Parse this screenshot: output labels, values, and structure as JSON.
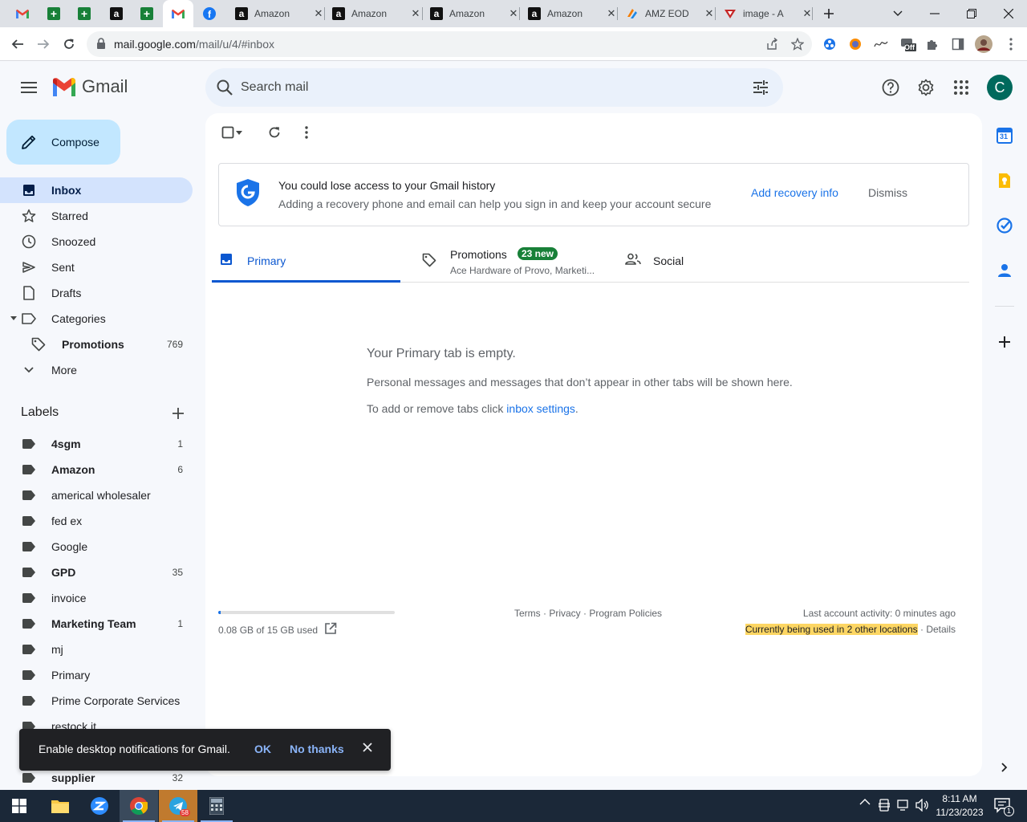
{
  "browser": {
    "tabs": [
      {
        "icon": "gmail-icon",
        "title": ""
      },
      {
        "icon": "sheets-icon",
        "title": ""
      },
      {
        "icon": "sheets-icon",
        "title": ""
      },
      {
        "icon": "amazon-icon",
        "title": ""
      },
      {
        "icon": "sheets-icon",
        "title": ""
      },
      {
        "icon": "gmail-icon",
        "title": "",
        "active": true
      },
      {
        "icon": "facebook-icon",
        "title": ""
      },
      {
        "icon": "amazon-icon",
        "title": "Amazon"
      },
      {
        "icon": "amazon-icon",
        "title": "Amazon"
      },
      {
        "icon": "amazon-icon",
        "title": "Amazon"
      },
      {
        "icon": "amazon-icon",
        "title": "Amazon"
      },
      {
        "icon": "amz-eod-icon",
        "title": "AMZ EOD"
      },
      {
        "icon": "image-tab-icon",
        "title": "image - A"
      }
    ],
    "url_host": "mail.google.com",
    "url_path": "/mail/u/4/#inbox",
    "extension_badge": "Off"
  },
  "gmail": {
    "product": "Gmail",
    "search_placeholder": "Search mail",
    "avatar_letter": "C",
    "compose": "Compose",
    "nav": [
      {
        "label": "Inbox",
        "icon": "inbox-icon",
        "active": true
      },
      {
        "label": "Starred",
        "icon": "star-icon"
      },
      {
        "label": "Snoozed",
        "icon": "clock-icon"
      },
      {
        "label": "Sent",
        "icon": "send-icon"
      },
      {
        "label": "Drafts",
        "icon": "draft-icon"
      },
      {
        "label": "Categories",
        "icon": "label-outline-icon"
      },
      {
        "label": "Promotions",
        "icon": "tag-icon",
        "count": "769"
      },
      {
        "label": "More",
        "icon": "chevron-down-icon"
      }
    ],
    "labels_title": "Labels",
    "labels": [
      {
        "name": "4sgm",
        "count": "1",
        "bold": true
      },
      {
        "name": "Amazon",
        "count": "6",
        "bold": true
      },
      {
        "name": "americal wholesaler",
        "count": ""
      },
      {
        "name": "fed ex",
        "count": ""
      },
      {
        "name": "Google",
        "count": ""
      },
      {
        "name": "GPD",
        "count": "35",
        "bold": true
      },
      {
        "name": "invoice",
        "count": ""
      },
      {
        "name": "Marketing Team",
        "count": "1",
        "bold": true
      },
      {
        "name": "mj",
        "count": ""
      },
      {
        "name": "Primary",
        "count": ""
      },
      {
        "name": "Prime Corporate Services",
        "count": ""
      },
      {
        "name": "restock it",
        "count": ""
      },
      {
        "name": "",
        "count": ""
      },
      {
        "name": "supplier",
        "count": "32",
        "bold": true
      }
    ],
    "banner": {
      "title": "You could lose access to your Gmail history",
      "subtitle": "Adding a recovery phone and email can help you sign in and keep your account secure",
      "action": "Add recovery info",
      "dismiss": "Dismiss"
    },
    "tabs": {
      "primary": "Primary",
      "promotions": "Promotions",
      "promotions_badge": "23 new",
      "promotions_preview": "Ace Hardware of Provo, Marketi...",
      "social": "Social"
    },
    "empty": {
      "title": "Your Primary tab is empty.",
      "line1": "Personal messages and messages that don’t appear in other tabs will be shown here.",
      "line2_prefix": "To add or remove tabs click ",
      "line2_link": "inbox settings",
      "line2_suffix": "."
    },
    "footer": {
      "storage": "0.08 GB of 15 GB used",
      "storage_fraction": 0.0053,
      "terms": "Terms",
      "privacy": "Privacy",
      "policies": "Program Policies",
      "sep": " · ",
      "activity": "Last account activity: 0 minutes ago",
      "locations": "Currently being used in 2 other locations",
      "details": "Details"
    },
    "notification": {
      "message": "Enable desktop notifications for Gmail.",
      "ok": "OK",
      "no_thanks": "No thanks"
    },
    "calendar_day": "31"
  },
  "taskbar": {
    "telegram_badge": "58",
    "time": "8:11 AM",
    "date": "11/23/2023",
    "notification_count": "1"
  }
}
